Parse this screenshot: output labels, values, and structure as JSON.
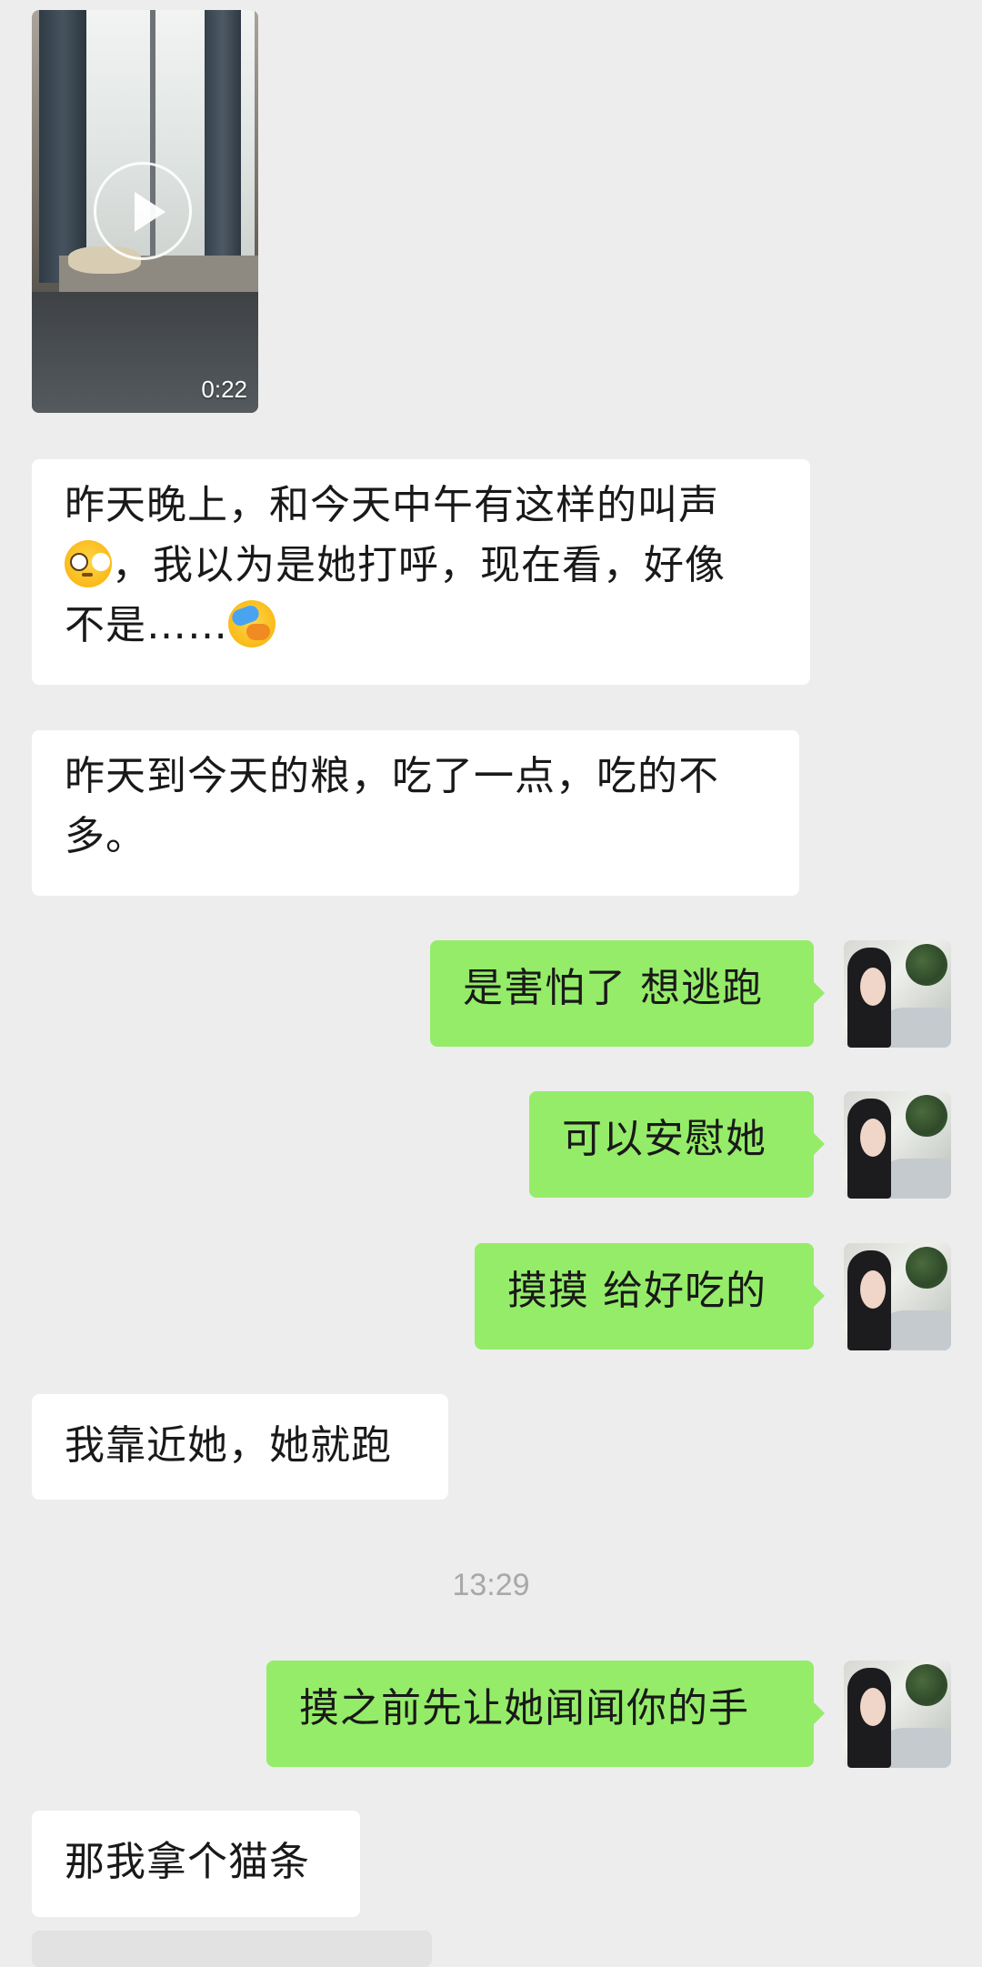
{
  "video": {
    "duration": "0:22"
  },
  "messages": [
    {
      "id": "m1",
      "side": "in",
      "text_parts": [
        "昨天晚上，和今天中午有这样的叫声",
        "，我以为是她打呼，现在看，好像",
        "不是……"
      ],
      "emojis": [
        "flushed-face",
        "face-palm"
      ]
    },
    {
      "id": "m2",
      "side": "in",
      "text": "昨天到今天的粮，吃了一点，吃的不多。"
    },
    {
      "id": "m3",
      "side": "out",
      "text": "是害怕了 想逃跑"
    },
    {
      "id": "m4",
      "side": "out",
      "text": "可以安慰她"
    },
    {
      "id": "m5",
      "side": "out",
      "text": "摸摸 给好吃的"
    },
    {
      "id": "m6",
      "side": "in",
      "text": "我靠近她，她就跑"
    },
    {
      "id": "m7",
      "side": "out",
      "text": "摸之前先让她闻闻你的手"
    },
    {
      "id": "m8",
      "side": "in",
      "text": "那我拿个猫条"
    }
  ],
  "timestamp": "13:29",
  "colors": {
    "background": "#ededed",
    "incoming_bubble": "#ffffff",
    "outgoing_bubble": "#95ec69",
    "timestamp_text": "#a8a8a8"
  }
}
